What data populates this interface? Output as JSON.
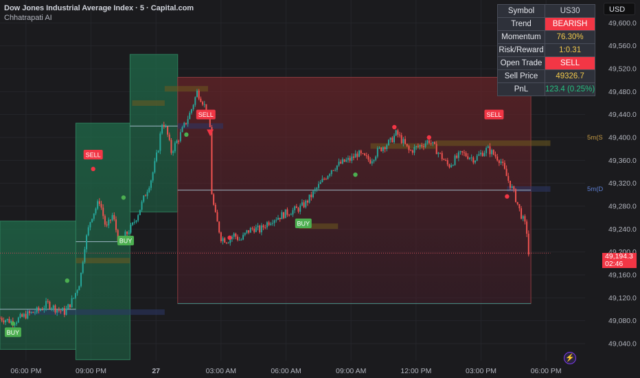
{
  "header": {
    "title": "Dow Jones Industrial Average Index · 5 · Capital.com",
    "subtitle": "Chhatrapati AI"
  },
  "currency": "USD",
  "info_table": [
    {
      "label": "Symbol",
      "value": "US30",
      "style": "plain"
    },
    {
      "label": "Trend",
      "value": "BEARISH",
      "style": "red"
    },
    {
      "label": "Momentum",
      "value": "76.30%",
      "style": "yellow"
    },
    {
      "label": "Risk/Reward",
      "value": "1:0.31",
      "style": "yellow"
    },
    {
      "label": "Open Trade",
      "value": "SELL",
      "style": "red"
    },
    {
      "label": "Sell Price",
      "value": "49326.7",
      "style": "yellow"
    },
    {
      "label": "PnL",
      "value": "123.4 (0.25%)",
      "style": "green"
    }
  ],
  "last_price": {
    "value": "49,194.3",
    "countdown": "02:46"
  },
  "colors": {
    "up": "#26a69a",
    "down": "#ef5350",
    "bg": "#1b1b1e",
    "buy_zone": "#1e5a3c",
    "sell_zone": "#5a2326",
    "label_sell": "#f23645",
    "label_buy": "#4caf50"
  },
  "level_labels": [
    {
      "text": "5m(S",
      "price": 49400,
      "color": "#c59b45"
    },
    {
      "text": "5m(D",
      "price": 49310,
      "color": "#5d7fd1"
    }
  ],
  "chart_data": {
    "type": "candlestick",
    "x_ticks": [
      {
        "label": "06:00 PM",
        "t": 0.6
      },
      {
        "label": "09:00 PM",
        "t": 3.6
      },
      {
        "label": "27",
        "t": 6.6
      },
      {
        "label": "03:00 AM",
        "t": 9.6
      },
      {
        "label": "06:00 AM",
        "t": 12.6
      },
      {
        "label": "09:00 AM",
        "t": 15.6
      },
      {
        "label": "12:00 PM",
        "t": 18.6
      },
      {
        "label": "03:00 PM",
        "t": 21.6
      },
      {
        "label": "06:00 PM",
        "t": 24.6
      }
    ],
    "y_ticks": [
      49600,
      49560,
      49520,
      49480,
      49440,
      49400,
      49360,
      49320,
      49280,
      49240,
      49200,
      49160,
      49120,
      49080,
      49040
    ],
    "ylim": [
      49010,
      49640
    ],
    "xlim": [
      -0.6,
      26.4
    ],
    "path": [
      [
        -0.6,
        49085
      ],
      [
        0.0,
        49078
      ],
      [
        0.6,
        49090
      ],
      [
        1.2,
        49098
      ],
      [
        1.6,
        49110
      ],
      [
        2.0,
        49100
      ],
      [
        2.4,
        49095
      ],
      [
        2.8,
        49120
      ],
      [
        3.1,
        49150
      ],
      [
        3.3,
        49210
      ],
      [
        3.6,
        49260
      ],
      [
        4.0,
        49290
      ],
      [
        4.3,
        49240
      ],
      [
        4.6,
        49265
      ],
      [
        4.9,
        49215
      ],
      [
        5.2,
        49230
      ],
      [
        5.5,
        49245
      ],
      [
        5.8,
        49270
      ],
      [
        6.1,
        49300
      ],
      [
        6.4,
        49330
      ],
      [
        6.7,
        49380
      ],
      [
        6.9,
        49430
      ],
      [
        7.1,
        49410
      ],
      [
        7.3,
        49375
      ],
      [
        7.6,
        49395
      ],
      [
        7.9,
        49420
      ],
      [
        8.2,
        49445
      ],
      [
        8.5,
        49480
      ],
      [
        8.8,
        49460
      ],
      [
        9.0,
        49435
      ],
      [
        9.1,
        49415
      ],
      [
        9.15,
        49310
      ],
      [
        9.3,
        49270
      ],
      [
        9.6,
        49225
      ],
      [
        9.9,
        49220
      ],
      [
        10.2,
        49230
      ],
      [
        10.5,
        49220
      ],
      [
        10.8,
        49235
      ],
      [
        11.1,
        49242
      ],
      [
        11.4,
        49238
      ],
      [
        11.7,
        49250
      ],
      [
        12.0,
        49258
      ],
      [
        12.3,
        49262
      ],
      [
        12.6,
        49268
      ],
      [
        12.9,
        49272
      ],
      [
        13.2,
        49276
      ],
      [
        13.5,
        49285
      ],
      [
        13.8,
        49300
      ],
      [
        14.1,
        49315
      ],
      [
        14.4,
        49330
      ],
      [
        14.7,
        49345
      ],
      [
        15.0,
        49352
      ],
      [
        15.3,
        49358
      ],
      [
        15.6,
        49362
      ],
      [
        15.9,
        49372
      ],
      [
        16.2,
        49365
      ],
      [
        16.5,
        49360
      ],
      [
        16.8,
        49375
      ],
      [
        17.1,
        49385
      ],
      [
        17.4,
        49392
      ],
      [
        17.7,
        49408
      ],
      [
        18.0,
        49392
      ],
      [
        18.3,
        49375
      ],
      [
        18.6,
        49382
      ],
      [
        18.9,
        49388
      ],
      [
        19.2,
        49395
      ],
      [
        19.5,
        49380
      ],
      [
        19.8,
        49365
      ],
      [
        20.1,
        49350
      ],
      [
        20.4,
        49362
      ],
      [
        20.7,
        49372
      ],
      [
        21.0,
        49368
      ],
      [
        21.3,
        49362
      ],
      [
        21.6,
        49372
      ],
      [
        21.9,
        49380
      ],
      [
        22.2,
        49370
      ],
      [
        22.5,
        49360
      ],
      [
        22.8,
        49330
      ],
      [
        23.1,
        49305
      ],
      [
        23.4,
        49270
      ],
      [
        23.7,
        49240
      ],
      [
        23.8,
        49194.3
      ]
    ],
    "zones": [
      {
        "kind": "buy",
        "x0": -0.6,
        "x1": 2.9,
        "y_top": 49254,
        "y_bot": 49030
      },
      {
        "kind": "buy",
        "x0": 2.9,
        "x1": 5.4,
        "y_top": 49425,
        "y_bot": 49012
      },
      {
        "kind": "buy",
        "x0": 5.4,
        "x1": 7.6,
        "y_top": 49545,
        "y_bot": 49270
      },
      {
        "kind": "sell",
        "x0": 7.6,
        "x1": 23.9,
        "y_top": 49505,
        "y_bot": 49110
      }
    ],
    "levels": [
      {
        "x0": -0.6,
        "x1": 2.9,
        "price": 49100,
        "color": "#9fb7c7"
      },
      {
        "x0": 2.9,
        "x1": 5.4,
        "price": 49218,
        "color": "#9fb7c7"
      },
      {
        "x0": 5.4,
        "x1": 7.6,
        "price": 49420,
        "color": "#9fb7c7"
      },
      {
        "x0": 7.6,
        "x1": 23.9,
        "price": 49308,
        "color": "#9fb7c7"
      },
      {
        "x0": 7.6,
        "x1": 23.9,
        "price": 49110,
        "color": "#3f8f87"
      },
      {
        "x0": -0.6,
        "x1": 24.8,
        "price": 49198,
        "color": "#c04a56",
        "dotted": true
      }
    ],
    "bands": [
      {
        "x0": 5.5,
        "x1": 7.0,
        "price": 49460,
        "color": "#6d5a1f"
      },
      {
        "x0": 7.0,
        "x1": 9.0,
        "price": 49485,
        "color": "#6d5a1f"
      },
      {
        "x0": 16.5,
        "x1": 19.5,
        "price": 49385,
        "color": "#6d5a1f"
      },
      {
        "x0": 19.5,
        "x1": 24.8,
        "price": 49390,
        "color": "#6d5a1f"
      },
      {
        "x0": 7.6,
        "x1": 9.7,
        "price": 49420,
        "color": "#2c3668"
      },
      {
        "x0": 22.8,
        "x1": 24.8,
        "price": 49310,
        "color": "#2c3668"
      },
      {
        "x0": 0.6,
        "x1": 7.0,
        "price": 49095,
        "color": "#2c3668"
      },
      {
        "x0": 2.9,
        "x1": 5.4,
        "price": 49185,
        "color": "#6d5a1f"
      },
      {
        "x0": 13.2,
        "x1": 15.0,
        "price": 49245,
        "color": "#6d5a1f"
      }
    ],
    "signals": [
      {
        "type": "SELL",
        "x": 3.7,
        "price": 49370
      },
      {
        "type": "BUY",
        "x": 5.2,
        "price": 49220
      },
      {
        "type": "SELL",
        "x": 8.9,
        "price": 49440
      },
      {
        "type": "BUY",
        "x": 0.0,
        "price": 49060
      },
      {
        "type": "BUY",
        "x": 13.4,
        "price": 49250
      },
      {
        "type": "SELL",
        "x": 22.2,
        "price": 49440
      }
    ],
    "dots": [
      {
        "x": 3.7,
        "price": 49345,
        "kind": "down"
      },
      {
        "x": 2.5,
        "price": 49150,
        "kind": "up"
      },
      {
        "x": 5.1,
        "price": 49295,
        "kind": "up"
      },
      {
        "x": 8.0,
        "price": 49405,
        "kind": "up"
      },
      {
        "x": 10.0,
        "price": 49225,
        "kind": "down"
      },
      {
        "x": 15.8,
        "price": 49335,
        "kind": "up"
      },
      {
        "x": 17.6,
        "price": 49418,
        "kind": "down"
      },
      {
        "x": 19.2,
        "price": 49400,
        "kind": "down"
      },
      {
        "x": 22.8,
        "price": 49297,
        "kind": "down"
      },
      {
        "x": 0.0,
        "price": 49075,
        "kind": "up"
      }
    ]
  }
}
